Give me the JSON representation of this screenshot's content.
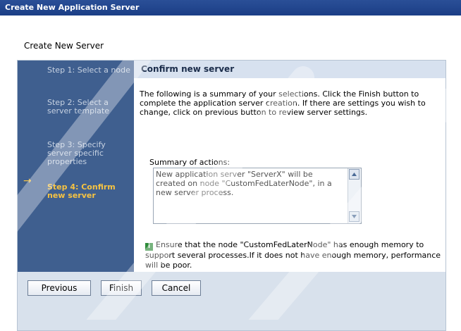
{
  "window": {
    "title": "Create New Application Server"
  },
  "wizard": {
    "subtitle": "Create New Server",
    "steps": [
      {
        "label": "Step 1: Select a node",
        "active": false
      },
      {
        "label": "Step 2: Select a server template",
        "active": false
      },
      {
        "label": "Step 3: Specify server specific properties",
        "active": false
      },
      {
        "label": "Step 4: Confirm new server",
        "active": true
      }
    ],
    "current_step_icon": "right-arrow-icon"
  },
  "main": {
    "heading": "Confirm new server",
    "description": "The following is a summary of your selections. Click the Finish button to complete the application server creation. If there are settings you wish to change, click on previous button to review server settings.",
    "summary_label": "Summary of actions:",
    "summary_text": "New application server \"ServerX\" will be created on node \"CustomFedLaterNode\", in a new server process.",
    "note_icon": "info-icon",
    "note_text": "Ensure that the node \"CustomFedLaterNode\" has enough memory to support several processes.If it does not have enough memory, performance will be poor."
  },
  "buttons": {
    "previous": "Previous",
    "finish": "Finish",
    "cancel": "Cancel"
  },
  "colors": {
    "titlebar": "#1b3e86",
    "sidebar": "#3f5f8f",
    "active_step": "#f6c342",
    "header_bg": "#d7e1ef",
    "panel_bg": "#d8e1ec"
  }
}
